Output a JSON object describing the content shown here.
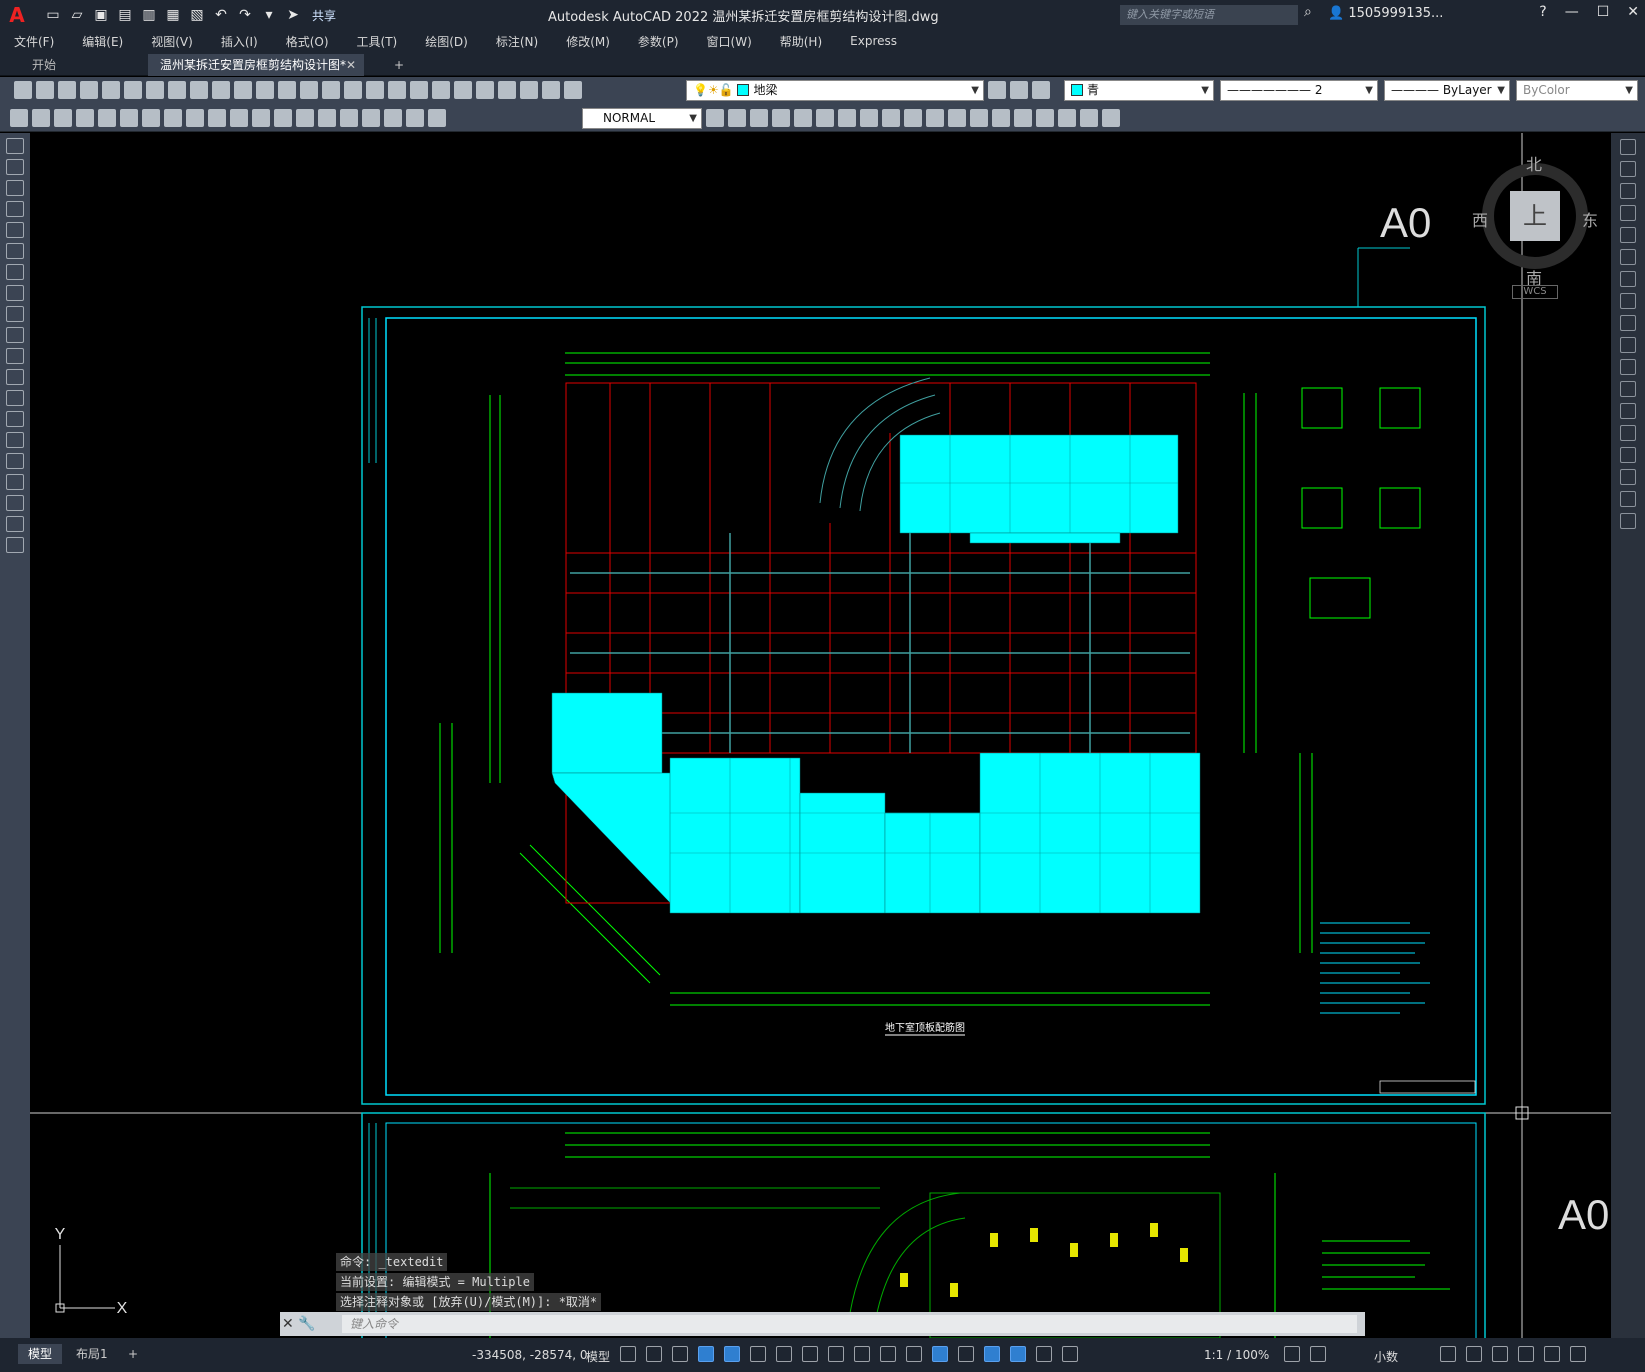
{
  "app": {
    "title": "Autodesk AutoCAD 2022    温州某拆迁安置房框剪结构设计图.dwg",
    "logo": "A",
    "share": "共享",
    "search_placeholder": "键入关键字或短语",
    "user": "1505999135...",
    "colors": {
      "drawing_cyan": "#00ffff",
      "accent_blue": "#2f7fd0",
      "frame_red": "#e00000",
      "grid_green": "#00ff00"
    }
  },
  "menu": [
    "文件(F)",
    "编辑(E)",
    "视图(V)",
    "插入(I)",
    "格式(O)",
    "工具(T)",
    "绘图(D)",
    "标注(N)",
    "修改(M)",
    "参数(P)",
    "窗口(W)",
    "帮助(H)",
    "Express"
  ],
  "tabs": {
    "start": "开始",
    "active": "温州某拆迁安置房框剪结构设计图*"
  },
  "toolbar": {
    "layer": "地梁",
    "color": "青",
    "linetype": "2",
    "lineweight": "ByLayer",
    "plotstyle": "ByColor",
    "dimstyle": "NORMAL"
  },
  "viewcube": {
    "north": "北",
    "south": "南",
    "east": "东",
    "west": "西",
    "face": "上",
    "wcs": "WCS"
  },
  "drawing": {
    "sheet_label_top": "A0",
    "sheet_label_bottom": "A0",
    "plan_title": "地下室顶板配筋图",
    "ucs_x": "X",
    "ucs_y": "Y"
  },
  "command": {
    "history": [
      "命令: _textedit",
      "当前设置: 编辑模式 = Multiple",
      "选择注释对象或 [放弃(U)/模式(M)]: *取消*"
    ],
    "placeholder": "键入命令"
  },
  "status": {
    "tab_model": "模型",
    "tab_layout": "布局1",
    "coords": "-334508, -28574, 0",
    "space": "模型",
    "scale": "1:1 / 100%",
    "units": "小数"
  }
}
